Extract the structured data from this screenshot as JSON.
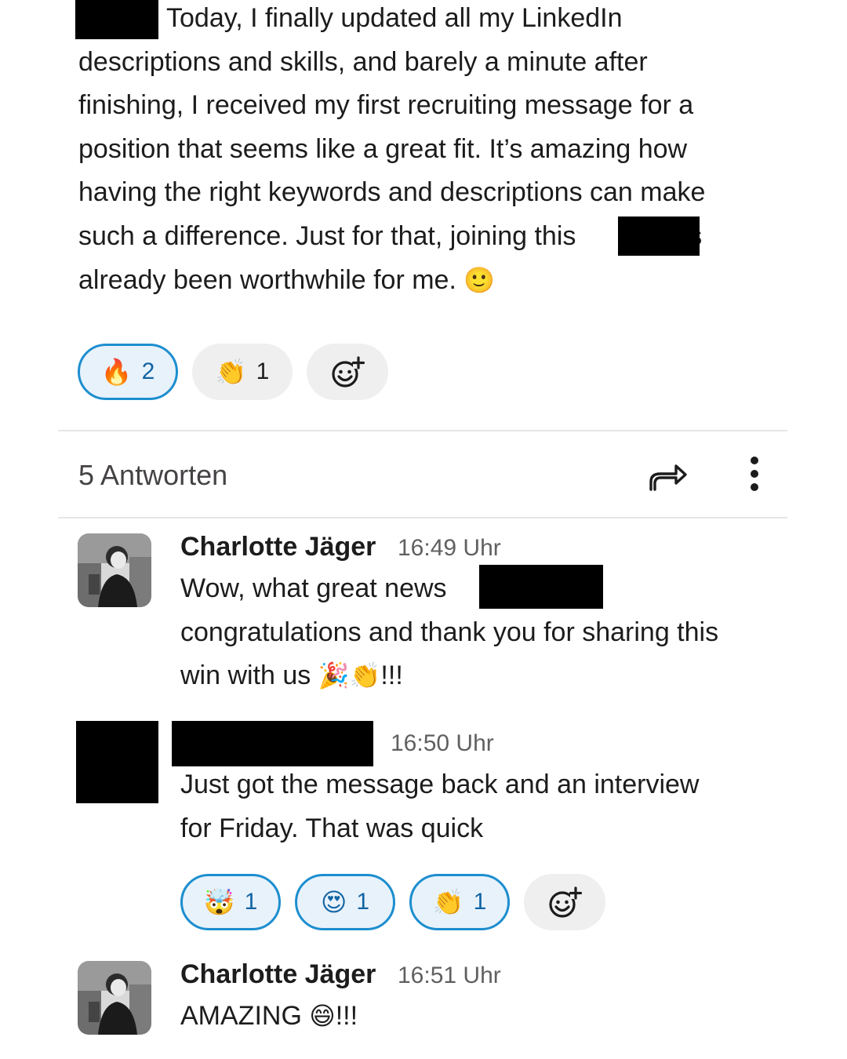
{
  "post": {
    "lines": [
      "Today, I finally updated all my LinkedIn",
      "descriptions and skills, and barely a minute after",
      "finishing, I received my first recruiting message for a",
      "position that seems like a great fit. It’s amazing how",
      "having the right keywords and descriptions can make",
      "such a difference. Just for that, joining this",
      "has",
      "already been worthwhile for me."
    ],
    "reactions": [
      {
        "emoji": "🔥",
        "count": "2"
      },
      {
        "emoji": "👏",
        "count": "1"
      }
    ]
  },
  "thread": {
    "replies_label": "5 Antworten"
  },
  "icons": {
    "share": "share-arrow-icon",
    "more": "more-vertical-icon",
    "add_reaction": "add-reaction-icon"
  },
  "replies": [
    {
      "author": "Charlotte Jäger",
      "time": "16:49 Uhr",
      "lines": [
        "Wow, what great news",
        "congratulations and thank you for sharing this",
        "win with us"
      ],
      "suffix": "!!!"
    },
    {
      "time": "16:50 Uhr",
      "lines": [
        "Just got the message back and an interview",
        "for Friday. That was quick"
      ],
      "reactions": [
        {
          "emoji": "🤯",
          "count": "1"
        },
        {
          "emoji": "😍",
          "count": "1"
        },
        {
          "emoji": "👏",
          "count": "1"
        }
      ]
    },
    {
      "author": "Charlotte Jäger",
      "time": "16:51 Uhr",
      "text": "AMAZING",
      "suffix": "!!!"
    }
  ]
}
